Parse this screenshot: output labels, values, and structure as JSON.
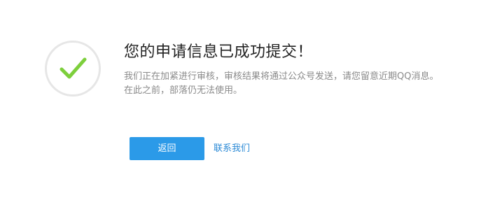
{
  "result": {
    "icon": "checkmark-icon",
    "icon_color": "#7dcf3c",
    "title": "您的申请信息已成功提交！",
    "description_lines": [
      "我们正在加紧进行审核，审核结果将通过公众号发送，请您留意近期QQ消息。",
      "在此之前，部落仍无法使用。"
    ]
  },
  "actions": {
    "back_label": "返回",
    "contact_label": "联系我们",
    "primary_color": "#2b9ae8",
    "link_color": "#2b8ad6"
  }
}
